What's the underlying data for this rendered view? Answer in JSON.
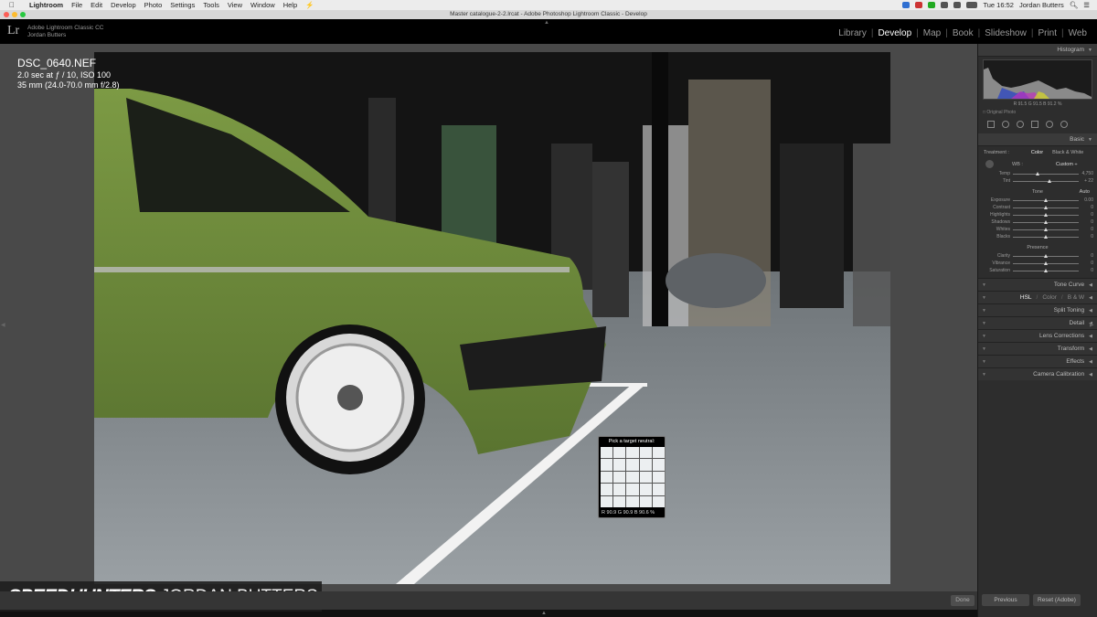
{
  "menubar": {
    "app": "Lightroom",
    "items": [
      "File",
      "Edit",
      "Develop",
      "Photo",
      "Settings",
      "Tools",
      "View",
      "Window",
      "Help"
    ],
    "clock": "Tue 16:52",
    "user": "Jordan Butters"
  },
  "window": {
    "title": "Master catalogue-2-2.lrcat - Adobe Photoshop Lightroom Classic - Develop"
  },
  "header": {
    "logo": "Lr",
    "product": "Adobe Lightroom Classic CC",
    "user": "Jordan Butters",
    "modules": [
      "Library",
      "Develop",
      "Map",
      "Book",
      "Slideshow",
      "Print",
      "Web"
    ],
    "active_module": "Develop"
  },
  "photo": {
    "filename": "DSC_0640.NEF",
    "exposure": "2.0 sec at ƒ / 10, ISO 100",
    "lens": "35 mm (24.0-70.0 mm f/2.8)"
  },
  "loupe": {
    "title": "Pick a target neutral:",
    "r_label": "R",
    "r": "90.9",
    "g_label": "G",
    "g": "90.9",
    "b_label": "B",
    "b": "90.6",
    "unit": "%"
  },
  "branding": {
    "bold": "SPEEDHUNTERS",
    "light": "JORDAN BUTTERS"
  },
  "toolbar": {
    "done": "Done"
  },
  "panel": {
    "histogram": "Histogram",
    "hist_values": "R 91.5 G 91.5 B 91.2 %",
    "original_photo": "Original Photo",
    "basic": "Basic",
    "treatment_label": "Treatment :",
    "treatment_color": "Color",
    "treatment_bw": "Black & White",
    "wb_label": "WB :",
    "wb_value": "Custom ÷",
    "tone_label": "Tone",
    "auto_label": "Auto",
    "presence_label": "Presence",
    "sliders_wb": [
      {
        "label": "Temp",
        "value": "4,750",
        "pos": 0.38
      },
      {
        "label": "Tint",
        "value": "+ 22",
        "pos": 0.55
      }
    ],
    "sliders_tone": [
      {
        "label": "Exposure",
        "value": "0.00",
        "pos": 0.5
      },
      {
        "label": "Contrast",
        "value": "0",
        "pos": 0.5
      },
      {
        "label": "Highlights",
        "value": "0",
        "pos": 0.5
      },
      {
        "label": "Shadows",
        "value": "0",
        "pos": 0.5
      },
      {
        "label": "Whites",
        "value": "0",
        "pos": 0.5
      },
      {
        "label": "Blacks",
        "value": "0",
        "pos": 0.5
      }
    ],
    "sliders_presence": [
      {
        "label": "Clarity",
        "value": "0",
        "pos": 0.5
      },
      {
        "label": "Vibrance",
        "value": "0",
        "pos": 0.5
      },
      {
        "label": "Saturation",
        "value": "0",
        "pos": 0.5
      }
    ],
    "sections": [
      "Tone Curve",
      "Split Toning",
      "Detail",
      "Lens Corrections",
      "Transform",
      "Effects",
      "Camera Calibration"
    ],
    "hsl": {
      "a": "HSL",
      "b": "Color",
      "c": "B & W",
      "sep": "/"
    },
    "previous": "Previous",
    "reset": "Reset (Adobe)"
  },
  "colors": {
    "car_green": "#6c8a38",
    "panel_bg": "#2d2d2d",
    "canvas_bg": "#494949"
  }
}
